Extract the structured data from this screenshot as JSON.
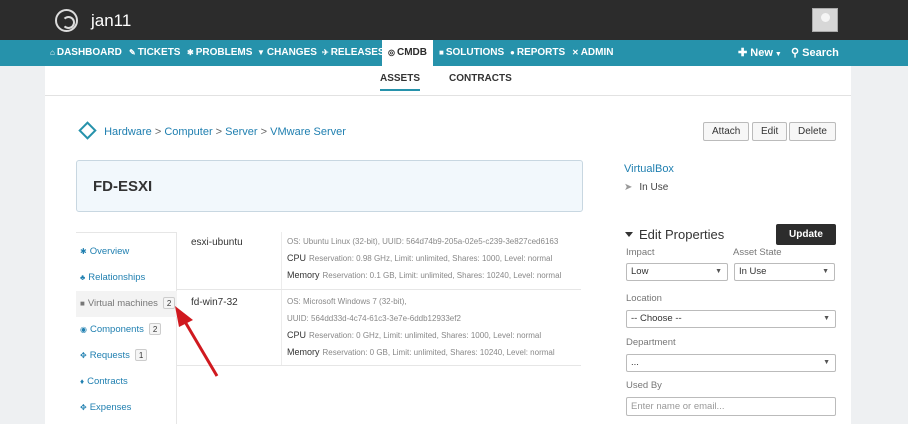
{
  "header": {
    "title": "jan11"
  },
  "nav": {
    "items": [
      {
        "icon": "⌂",
        "label": "DASHBOARD"
      },
      {
        "icon": "✎",
        "label": "TICKETS"
      },
      {
        "icon": "✱",
        "label": "PROBLEMS"
      },
      {
        "icon": "▼",
        "label": "CHANGES"
      },
      {
        "icon": "✈",
        "label": "RELEASES"
      },
      {
        "icon": "◎",
        "label": "CMDB"
      },
      {
        "icon": "■",
        "label": "SOLUTIONS"
      },
      {
        "icon": "●",
        "label": "REPORTS"
      },
      {
        "icon": "✕",
        "label": "ADMIN"
      }
    ],
    "new_label": "New",
    "search_label": "Search"
  },
  "subtabs": {
    "assets": "ASSETS",
    "contracts": "CONTRACTS"
  },
  "breadcrumb": {
    "items": [
      "Hardware",
      "Computer",
      "Server",
      "VMware Server"
    ],
    "separator": ">"
  },
  "actions": {
    "attach": "Attach",
    "edit": "Edit",
    "delete": "Delete"
  },
  "asset": {
    "name": "FD-ESXI",
    "related_name": "VirtualBox",
    "status": "In Use"
  },
  "sidebar": {
    "items": [
      {
        "icon": "✱",
        "label": "Overview"
      },
      {
        "icon": "♣",
        "label": "Relationships"
      },
      {
        "icon": "■",
        "label": "Virtual machines",
        "count": "2"
      },
      {
        "icon": "◉",
        "label": "Components",
        "count": "2"
      },
      {
        "icon": "✥",
        "label": "Requests",
        "count": "1"
      },
      {
        "icon": "♦",
        "label": "Contracts"
      },
      {
        "icon": "✥",
        "label": "Expenses"
      }
    ]
  },
  "vms": [
    {
      "name": "esxi-ubuntu",
      "os_line": "OS: Ubuntu Linux (32-bit), UUID: 564d74b9-205a-02e5-c239-3e827ced6163",
      "cpu_label": "CPU",
      "cpu_details": "Reservation: 0.98 GHz, Limit: unlimited, Shares: 1000, Level: normal",
      "mem_label": "Memory",
      "mem_details": "Reservation: 0.1 GB, Limit: unlimited, Shares: 10240, Level: normal"
    },
    {
      "name": "fd-win7-32",
      "os_line": "OS: Microsoft Windows 7 (32-bit),",
      "uuid_line": "UUID: 564dd33d-4c74-61c3-3e7e-6ddb12933ef2",
      "cpu_label": "CPU",
      "cpu_details": "Reservation: 0 GHz, Limit: unlimited, Shares: 1000, Level: normal",
      "mem_label": "Memory",
      "mem_details": "Reservation: 0 GB, Limit: unlimited, Shares: 10240, Level: normal"
    }
  ],
  "edit_properties": {
    "title": "Edit Properties",
    "update_label": "Update",
    "impact_label": "Impact",
    "impact_value": "Low",
    "state_label": "Asset State",
    "state_value": "In Use",
    "location_label": "Location",
    "location_value": "-- Choose --",
    "department_label": "Department",
    "department_value": "...",
    "used_by_label": "Used By",
    "used_by_placeholder": "Enter name or email..."
  },
  "colors": {
    "nav": "#2692ab",
    "topbar": "#2c2c2c",
    "link": "#1f7fb0",
    "arrow": "#d0191f"
  }
}
